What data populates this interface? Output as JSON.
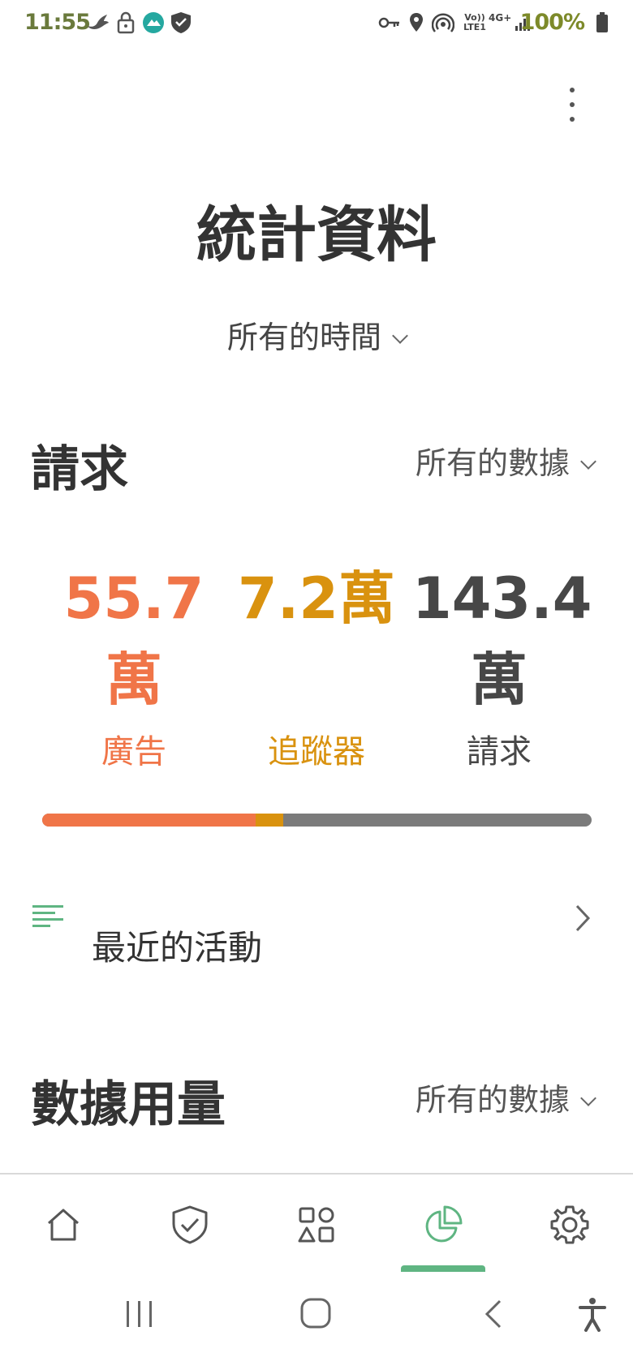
{
  "status_bar": {
    "time": "11:55",
    "network_type": "4G+",
    "volte_label": "Vo)) LTE1",
    "battery": "100%"
  },
  "header": {
    "menu_icon": "more-vertical-icon",
    "title": "統計資料",
    "time_filter": "所有的時間"
  },
  "requests_section": {
    "title": "請求",
    "filter": "所有的數據",
    "stats": [
      {
        "value_line1": "55.7",
        "value_line2": "萬",
        "label": "廣告",
        "color": "#f07548"
      },
      {
        "value_line1": "7.2萬",
        "value_line2": "",
        "label": "追蹤器",
        "color": "#d9920f"
      },
      {
        "value_line1": "143.4",
        "value_line2": "萬",
        "label": "請求",
        "color": "#474747"
      }
    ],
    "bar": {
      "ads_fraction": 0.388,
      "trackers_fraction": 0.05,
      "ads_color": "#f07548",
      "trackers_color": "#d9920f",
      "rest_color": "#7b7b7b"
    }
  },
  "recent_activity": {
    "label": "最近的活動",
    "icon": "list-lines-icon"
  },
  "data_usage_section": {
    "title": "數據用量",
    "filter": "所有的數據"
  },
  "bottom_nav": {
    "items": [
      {
        "icon": "home-icon",
        "active": false
      },
      {
        "icon": "shield-check-icon",
        "active": false
      },
      {
        "icon": "apps-grid-icon",
        "active": false
      },
      {
        "icon": "pie-chart-icon",
        "active": true
      },
      {
        "icon": "gear-icon",
        "active": false
      }
    ],
    "accent": "#5fb582"
  },
  "system_nav": {
    "items": [
      "recents-icon",
      "home-circle-icon",
      "back-icon",
      "accessibility-icon"
    ]
  }
}
